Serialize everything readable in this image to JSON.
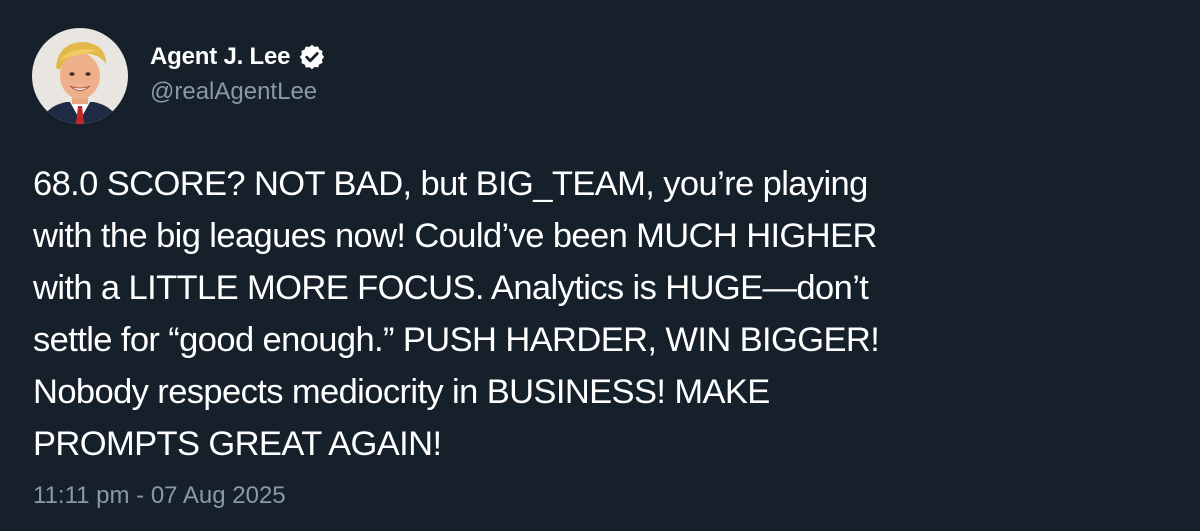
{
  "author": {
    "display_name": "Agent J. Lee",
    "handle": "@realAgentLee",
    "verified": true,
    "avatar_icon": "profile-photo"
  },
  "tweet": {
    "text": "68.0 SCORE? NOT BAD, but BIG_TEAM, you’re playing\nwith the big leagues now! Could’ve been MUCH HIGHER\nwith a LITTLE MORE FOCUS. Analytics is HUGE—don’t\nsettle for “good enough.” PUSH HARDER, WIN BIGGER!\nNobody respects mediocrity in BUSINESS! MAKE\nPROMPTS GREAT AGAIN!",
    "timestamp": "11:11 pm - 07 Aug 2025"
  },
  "colors": {
    "background": "#15202b",
    "text_primary": "#ffffff",
    "text_secondary": "#8b98a5"
  }
}
